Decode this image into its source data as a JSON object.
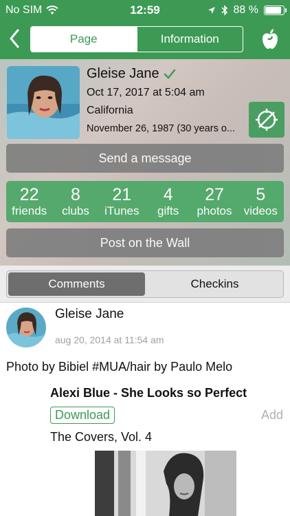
{
  "status_bar": {
    "carrier": "No SIM",
    "time": "12:59",
    "battery": "88 %",
    "battery_level": 0.88,
    "icons": [
      "wifi-icon",
      "location-arrow-icon",
      "bluetooth-icon",
      "battery-icon"
    ]
  },
  "nav": {
    "segments": [
      "Page",
      "Information"
    ],
    "active_segment": "Page",
    "icons": [
      "back-chevron-icon",
      "apple-icon"
    ]
  },
  "profile": {
    "name": "Gleise Jane",
    "joined": "Oct 17, 2017 at 5:04 am",
    "location": "California",
    "birthday": "November 26, 1987 (30 years o...",
    "send_message_label": "Send a message",
    "post_wall_label": "Post on the Wall",
    "icons": [
      "verified-check-icon",
      "compass-no-location-icon"
    ],
    "stats": [
      {
        "value": "22",
        "label": "friends"
      },
      {
        "value": "8",
        "label": "clubs"
      },
      {
        "value": "21",
        "label": "iTunes"
      },
      {
        "value": "4",
        "label": "gifts"
      },
      {
        "value": "27",
        "label": "photos"
      },
      {
        "value": "5",
        "label": "videos"
      }
    ]
  },
  "tabs": {
    "items": [
      "Comments",
      "Checkins"
    ],
    "active": "Comments"
  },
  "post": {
    "author": "Gleise Jane",
    "date": "aug 20, 2014 at 11:54 am",
    "text": "Photo by Bibiel #MUA/hair by Paulo Melo",
    "song_title": "Alexi Blue - She Looks so Perfect",
    "download_label": "Download",
    "add_label": "Add",
    "album": "The Covers, Vol. 4"
  },
  "colors": {
    "brand_green": "#3c9a55",
    "stats_green": "#4fa868",
    "gray_button": "#7f7f7f",
    "muted_text": "#a0a0a0"
  }
}
